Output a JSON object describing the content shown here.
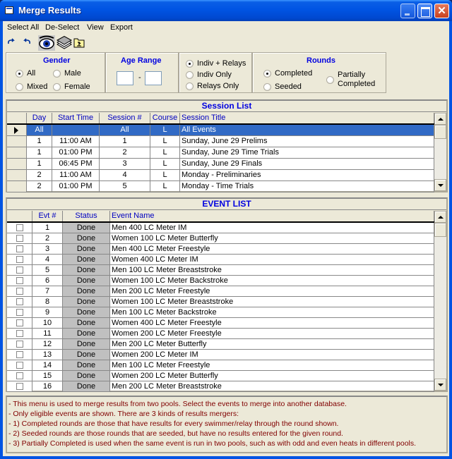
{
  "window": {
    "title": "Merge Results"
  },
  "menu": [
    "Select All",
    "De-Select",
    "View",
    "Export"
  ],
  "toolbar": {
    "icons": [
      "redo-icon",
      "undo-icon",
      "eye-icon",
      "disk-stack-icon",
      "folder-up-icon"
    ]
  },
  "gender": {
    "title": "Gender",
    "options": [
      {
        "label": "All",
        "selected": true
      },
      {
        "label": "Male",
        "selected": false
      },
      {
        "label": "Mixed",
        "selected": false
      },
      {
        "label": "Female",
        "selected": false
      }
    ]
  },
  "age_range": {
    "title": "Age Range",
    "from": "",
    "to": "",
    "separator": "-"
  },
  "event_type": {
    "options": [
      {
        "label": "Indiv + Relays",
        "selected": true
      },
      {
        "label": "Indiv Only",
        "selected": false
      },
      {
        "label": "Relays Only",
        "selected": false
      }
    ]
  },
  "rounds": {
    "title": "Rounds",
    "options": [
      {
        "label": "Completed",
        "selected": true
      },
      {
        "label": "Seeded",
        "selected": false
      },
      {
        "label": "Partially",
        "label2": "Completed",
        "selected": false
      }
    ]
  },
  "session_list": {
    "caption": "Session List",
    "columns": [
      "Day",
      "Start Time",
      "Session #",
      "Course",
      "Session Title"
    ],
    "rows": [
      {
        "day": "All",
        "start": "",
        "session": "All",
        "course": "L",
        "title": "All Events",
        "selected": true
      },
      {
        "day": "1",
        "start": "11:00 AM",
        "session": "1",
        "course": "L",
        "title": "Sunday, June 29 Prelims"
      },
      {
        "day": "1",
        "start": "01:00 PM",
        "session": "2",
        "course": "L",
        "title": "Sunday, June 29 Time Trials"
      },
      {
        "day": "1",
        "start": "06:45 PM",
        "session": "3",
        "course": "L",
        "title": "Sunday, June 29 Finals"
      },
      {
        "day": "2",
        "start": "11:00 AM",
        "session": "4",
        "course": "L",
        "title": "Monday - Preliminaries"
      },
      {
        "day": "2",
        "start": "01:00 PM",
        "session": "5",
        "course": "L",
        "title": "Monday - Time Trials"
      }
    ]
  },
  "event_list": {
    "caption": "EVENT LIST",
    "columns": [
      "Evt #",
      "Status",
      "Event Name"
    ],
    "rows": [
      {
        "evt": "1",
        "status": "Done",
        "name": "Men 400 LC Meter IM"
      },
      {
        "evt": "2",
        "status": "Done",
        "name": "Women 100 LC Meter Butterfly"
      },
      {
        "evt": "3",
        "status": "Done",
        "name": "Men 400 LC Meter Freestyle"
      },
      {
        "evt": "4",
        "status": "Done",
        "name": "Women 400 LC Meter IM"
      },
      {
        "evt": "5",
        "status": "Done",
        "name": "Men 100 LC Meter Breaststroke"
      },
      {
        "evt": "6",
        "status": "Done",
        "name": "Women 100 LC Meter Backstroke"
      },
      {
        "evt": "7",
        "status": "Done",
        "name": "Men 200 LC Meter Freestyle"
      },
      {
        "evt": "8",
        "status": "Done",
        "name": "Women 100 LC Meter Breaststroke"
      },
      {
        "evt": "9",
        "status": "Done",
        "name": "Men 100 LC Meter Backstroke"
      },
      {
        "evt": "10",
        "status": "Done",
        "name": "Women 400 LC Meter Freestyle"
      },
      {
        "evt": "11",
        "status": "Done",
        "name": "Women 200 LC Meter Freestyle"
      },
      {
        "evt": "12",
        "status": "Done",
        "name": "Men 200 LC Meter Butterfly"
      },
      {
        "evt": "13",
        "status": "Done",
        "name": "Women 200 LC Meter IM"
      },
      {
        "evt": "14",
        "status": "Done",
        "name": "Men 100 LC Meter Freestyle"
      },
      {
        "evt": "15",
        "status": "Done",
        "name": "Women 200 LC Meter Butterfly"
      },
      {
        "evt": "16",
        "status": "Done",
        "name": "Men 200 LC Meter Breaststroke"
      }
    ]
  },
  "info_lines": [
    "- This menu is used to merge results from two pools.  Select the events to merge into another database.",
    "- Only eligible events are shown. There are 3 kinds of results mergers:",
    "- 1) Completed rounds are those that have results for every swimmer/relay through the round shown.",
    "- 2) Seeded rounds are those rounds that are seeded, but have no results entered for the given round.",
    "- 3) Partially Completed is used when the same event is run in two pools, such as with odd and even heats in different pools."
  ]
}
